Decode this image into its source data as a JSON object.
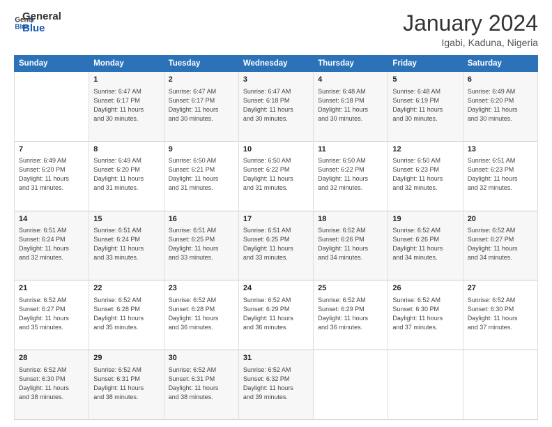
{
  "logo": {
    "line1": "General",
    "line2": "Blue"
  },
  "title": "January 2024",
  "location": "Igabi, Kaduna, Nigeria",
  "header_days": [
    "Sunday",
    "Monday",
    "Tuesday",
    "Wednesday",
    "Thursday",
    "Friday",
    "Saturday"
  ],
  "weeks": [
    [
      {
        "num": "",
        "info": ""
      },
      {
        "num": "1",
        "info": "Sunrise: 6:47 AM\nSunset: 6:17 PM\nDaylight: 11 hours\nand 30 minutes."
      },
      {
        "num": "2",
        "info": "Sunrise: 6:47 AM\nSunset: 6:17 PM\nDaylight: 11 hours\nand 30 minutes."
      },
      {
        "num": "3",
        "info": "Sunrise: 6:47 AM\nSunset: 6:18 PM\nDaylight: 11 hours\nand 30 minutes."
      },
      {
        "num": "4",
        "info": "Sunrise: 6:48 AM\nSunset: 6:18 PM\nDaylight: 11 hours\nand 30 minutes."
      },
      {
        "num": "5",
        "info": "Sunrise: 6:48 AM\nSunset: 6:19 PM\nDaylight: 11 hours\nand 30 minutes."
      },
      {
        "num": "6",
        "info": "Sunrise: 6:49 AM\nSunset: 6:20 PM\nDaylight: 11 hours\nand 30 minutes."
      }
    ],
    [
      {
        "num": "7",
        "info": "Sunrise: 6:49 AM\nSunset: 6:20 PM\nDaylight: 11 hours\nand 31 minutes."
      },
      {
        "num": "8",
        "info": "Sunrise: 6:49 AM\nSunset: 6:20 PM\nDaylight: 11 hours\nand 31 minutes."
      },
      {
        "num": "9",
        "info": "Sunrise: 6:50 AM\nSunset: 6:21 PM\nDaylight: 11 hours\nand 31 minutes."
      },
      {
        "num": "10",
        "info": "Sunrise: 6:50 AM\nSunset: 6:22 PM\nDaylight: 11 hours\nand 31 minutes."
      },
      {
        "num": "11",
        "info": "Sunrise: 6:50 AM\nSunset: 6:22 PM\nDaylight: 11 hours\nand 32 minutes."
      },
      {
        "num": "12",
        "info": "Sunrise: 6:50 AM\nSunset: 6:23 PM\nDaylight: 11 hours\nand 32 minutes."
      },
      {
        "num": "13",
        "info": "Sunrise: 6:51 AM\nSunset: 6:23 PM\nDaylight: 11 hours\nand 32 minutes."
      }
    ],
    [
      {
        "num": "14",
        "info": "Sunrise: 6:51 AM\nSunset: 6:24 PM\nDaylight: 11 hours\nand 32 minutes."
      },
      {
        "num": "15",
        "info": "Sunrise: 6:51 AM\nSunset: 6:24 PM\nDaylight: 11 hours\nand 33 minutes."
      },
      {
        "num": "16",
        "info": "Sunrise: 6:51 AM\nSunset: 6:25 PM\nDaylight: 11 hours\nand 33 minutes."
      },
      {
        "num": "17",
        "info": "Sunrise: 6:51 AM\nSunset: 6:25 PM\nDaylight: 11 hours\nand 33 minutes."
      },
      {
        "num": "18",
        "info": "Sunrise: 6:52 AM\nSunset: 6:26 PM\nDaylight: 11 hours\nand 34 minutes."
      },
      {
        "num": "19",
        "info": "Sunrise: 6:52 AM\nSunset: 6:26 PM\nDaylight: 11 hours\nand 34 minutes."
      },
      {
        "num": "20",
        "info": "Sunrise: 6:52 AM\nSunset: 6:27 PM\nDaylight: 11 hours\nand 34 minutes."
      }
    ],
    [
      {
        "num": "21",
        "info": "Sunrise: 6:52 AM\nSunset: 6:27 PM\nDaylight: 11 hours\nand 35 minutes."
      },
      {
        "num": "22",
        "info": "Sunrise: 6:52 AM\nSunset: 6:28 PM\nDaylight: 11 hours\nand 35 minutes."
      },
      {
        "num": "23",
        "info": "Sunrise: 6:52 AM\nSunset: 6:28 PM\nDaylight: 11 hours\nand 36 minutes."
      },
      {
        "num": "24",
        "info": "Sunrise: 6:52 AM\nSunset: 6:29 PM\nDaylight: 11 hours\nand 36 minutes."
      },
      {
        "num": "25",
        "info": "Sunrise: 6:52 AM\nSunset: 6:29 PM\nDaylight: 11 hours\nand 36 minutes."
      },
      {
        "num": "26",
        "info": "Sunrise: 6:52 AM\nSunset: 6:30 PM\nDaylight: 11 hours\nand 37 minutes."
      },
      {
        "num": "27",
        "info": "Sunrise: 6:52 AM\nSunset: 6:30 PM\nDaylight: 11 hours\nand 37 minutes."
      }
    ],
    [
      {
        "num": "28",
        "info": "Sunrise: 6:52 AM\nSunset: 6:30 PM\nDaylight: 11 hours\nand 38 minutes."
      },
      {
        "num": "29",
        "info": "Sunrise: 6:52 AM\nSunset: 6:31 PM\nDaylight: 11 hours\nand 38 minutes."
      },
      {
        "num": "30",
        "info": "Sunrise: 6:52 AM\nSunset: 6:31 PM\nDaylight: 11 hours\nand 38 minutes."
      },
      {
        "num": "31",
        "info": "Sunrise: 6:52 AM\nSunset: 6:32 PM\nDaylight: 11 hours\nand 39 minutes."
      },
      {
        "num": "",
        "info": ""
      },
      {
        "num": "",
        "info": ""
      },
      {
        "num": "",
        "info": ""
      }
    ]
  ]
}
